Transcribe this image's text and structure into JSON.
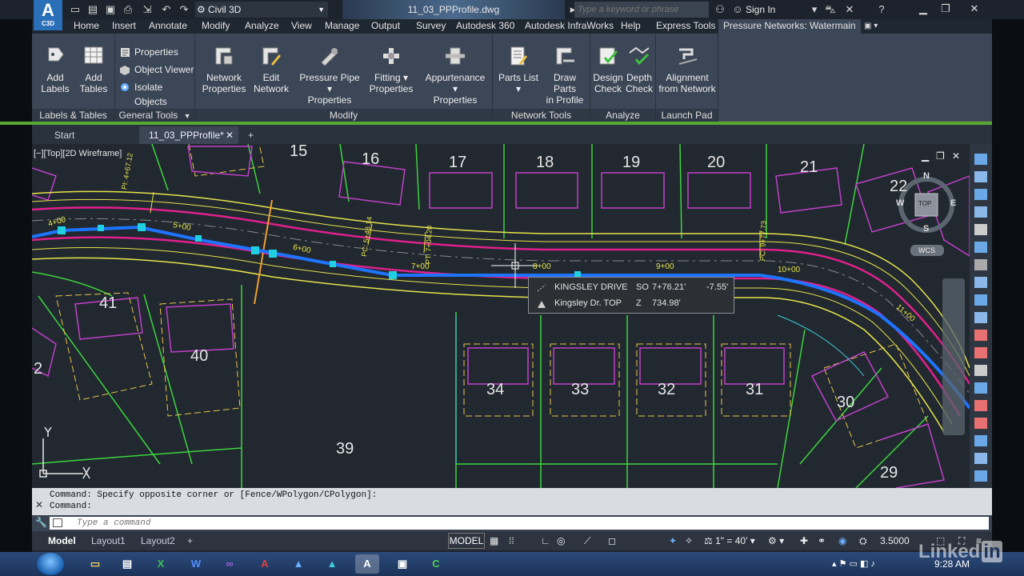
{
  "titlebar": {
    "app_logo_letter": "A",
    "app_logo_sub": "C3D",
    "workspace": "Civil 3D",
    "document_title": "11_03_PPProfile.dwg",
    "search_placeholder": "Type a keyword or phrase",
    "sign_in": "Sign In"
  },
  "ribbon_tabs": [
    "Home",
    "Insert",
    "Annotate",
    "Modify",
    "Analyze",
    "View",
    "Manage",
    "Output",
    "Survey",
    "Autodesk 360",
    "Autodesk InfraWorks",
    "Help",
    "Express Tools",
    "Pressure Networks: Watermain"
  ],
  "ribbon": {
    "labels_tables": {
      "title": "Labels & Tables",
      "add_labels": [
        "Add",
        "Labels"
      ],
      "add_tables": [
        "Add",
        "Tables"
      ]
    },
    "general_tools": {
      "title": "General Tools",
      "properties": "Properties",
      "object_viewer": "Object Viewer",
      "isolate_objects": "Isolate Objects"
    },
    "modify": {
      "title": "Modify",
      "network_properties": [
        "Network",
        "Properties"
      ],
      "edit_network": [
        "Edit",
        "Network"
      ],
      "pressure_pipe_properties": [
        "Pressure Pipe",
        "Properties"
      ],
      "fitting_properties": [
        "Fitting",
        "Properties"
      ],
      "appurtenance_properties": [
        "Appurtenance",
        "Properties"
      ]
    },
    "network_tools": {
      "title": "Network Tools",
      "parts_list": [
        "Parts List",
        ""
      ],
      "draw_parts_in_profile": [
        "Draw Parts",
        "in Profile"
      ]
    },
    "analyze": {
      "title": "Analyze",
      "design_check": [
        "Design",
        "Check"
      ],
      "depth_check": [
        "Depth",
        "Check"
      ]
    },
    "launch_pad": {
      "title": "Launch Pad",
      "alignment_from_network": [
        "Alignment",
        "from Network"
      ]
    }
  },
  "doc_tabs": [
    "Start",
    "11_03_PPProfile*"
  ],
  "viewport": {
    "label": "[−][Top][2D Wireframe]",
    "lot_numbers": [
      "15",
      "16",
      "17",
      "18",
      "19",
      "20",
      "21",
      "22",
      "41",
      "40",
      "2",
      "39",
      "34",
      "33",
      "32",
      "31",
      "30",
      "29"
    ],
    "stations": [
      "4+00",
      "5+00",
      "6+00",
      "7+00",
      "8+00",
      "9+00",
      "10+00",
      "11+00"
    ],
    "station_marks": [
      "PI: 4+67.12",
      "PC: 5+48.14",
      "PT: 7+04.20",
      "PC: 9+77.73"
    ],
    "compass": {
      "n": "N",
      "s": "S",
      "e": "E",
      "w": "W",
      "top": "TOP",
      "wcs": "WCS"
    }
  },
  "tooltip": {
    "row1": {
      "name": "KINGSLEY DRIVE",
      "key": "SO",
      "station": "7+76.21'",
      "offset": "-7.55'"
    },
    "row2": {
      "name": "Kingsley Dr. TOP",
      "key": "Z",
      "value": "734.98'"
    }
  },
  "command": {
    "history_1": "Command: Specify opposite corner or [Fence/WPolygon/CPolygon]:",
    "history_2": "Command:",
    "placeholder": "Type a command"
  },
  "statusbar": {
    "layouts": [
      "Model",
      "Layout1",
      "Layout2"
    ],
    "model_btn": "MODEL",
    "scale": "1\" = 40'",
    "value": "3.5000"
  },
  "taskbar": {
    "clock": "9:28 AM"
  },
  "watermark": "Linked",
  "watermark_in": "in",
  "colors": {
    "pipe": "#1e74ff",
    "road_magenta": "#e0208c",
    "road_yellow": "#e7e34a",
    "lot_green": "#3ed43e",
    "house_magenta": "#c040c8"
  }
}
